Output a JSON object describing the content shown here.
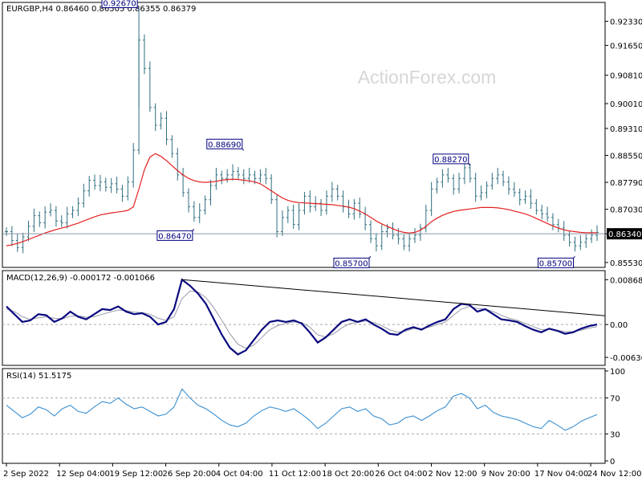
{
  "chart_data": [
    {
      "type": "ohlc",
      "symbol_info": "EURGBP,H4  0.86460 0.86505 0.86355 0.86379",
      "watermark": "ActionForex.com",
      "ylim": [
        0.8546,
        0.9275
      ],
      "y_ticks": [
        "0.92330",
        "0.91650",
        "0.90810",
        "0.90010",
        "0.89310",
        "0.88550",
        "0.87790",
        "0.87030",
        "0.86340",
        "0.85530"
      ],
      "current_price": "0.86340",
      "current_value": 0.8634,
      "x_labels": [
        "2 Sep 2022",
        "12 Sep 04:00",
        "19 Sep 12:00",
        "26 Sep 20:00",
        "4 Oct 04:00",
        "11 Oct 12:00",
        "18 Oct 20:00",
        "26 Oct 04:00",
        "2 Nov 12:00",
        "9 Nov 20:00",
        "17 Nov 04:00",
        "24 Nov 12:00"
      ],
      "closes": [
        0.864,
        0.8615,
        0.8595,
        0.8625,
        0.8655,
        0.8685,
        0.8665,
        0.8695,
        0.87,
        0.867,
        0.8665,
        0.869,
        0.87,
        0.872,
        0.8755,
        0.8785,
        0.877,
        0.878,
        0.8765,
        0.8775,
        0.876,
        0.874,
        0.878,
        0.887,
        0.918,
        0.91,
        0.899,
        0.894,
        0.896,
        0.89,
        0.886,
        0.88,
        0.875,
        0.871,
        0.868,
        0.87,
        0.873,
        0.877,
        0.88,
        0.879,
        0.88,
        0.881,
        0.88,
        0.879,
        0.88,
        0.879,
        0.88,
        0.879,
        0.873,
        0.864,
        0.868,
        0.87,
        0.866,
        0.87,
        0.874,
        0.871,
        0.872,
        0.87,
        0.874,
        0.876,
        0.874,
        0.871,
        0.869,
        0.872,
        0.869,
        0.866,
        0.862,
        0.86,
        0.864,
        0.865,
        0.863,
        0.862,
        0.86,
        0.862,
        0.863,
        0.865,
        0.87,
        0.876,
        0.878,
        0.88,
        0.879,
        0.876,
        0.879,
        0.882,
        0.879,
        0.874,
        0.875,
        0.877,
        0.879,
        0.88,
        0.878,
        0.876,
        0.875,
        0.873,
        0.874,
        0.872,
        0.87,
        0.869,
        0.868,
        0.866,
        0.865,
        0.863,
        0.861,
        0.86,
        0.861,
        0.862,
        0.863,
        0.8638
      ],
      "ma": [
        0.86,
        0.8603,
        0.8607,
        0.8612,
        0.8618,
        0.8624,
        0.863,
        0.8636,
        0.8641,
        0.8646,
        0.865,
        0.8654,
        0.8659,
        0.8664,
        0.867,
        0.8676,
        0.8682,
        0.8687,
        0.869,
        0.8693,
        0.8695,
        0.8697,
        0.87,
        0.871,
        0.876,
        0.8815,
        0.885,
        0.886,
        0.8852,
        0.884,
        0.8826,
        0.8812,
        0.88,
        0.879,
        0.8784,
        0.878,
        0.8779,
        0.878,
        0.8782,
        0.8785,
        0.8787,
        0.8788,
        0.8787,
        0.8785,
        0.8783,
        0.878,
        0.8775,
        0.8765,
        0.8755,
        0.8745,
        0.8735,
        0.8728,
        0.8724,
        0.8722,
        0.8721,
        0.872,
        0.8719,
        0.8718,
        0.8717,
        0.8716,
        0.8714,
        0.8712,
        0.8709,
        0.8705,
        0.8698,
        0.869,
        0.868,
        0.867,
        0.8662,
        0.8655,
        0.8648,
        0.8642,
        0.8638,
        0.8636,
        0.8638,
        0.8644,
        0.8655,
        0.8668,
        0.8678,
        0.8686,
        0.8692,
        0.8697,
        0.87,
        0.8702,
        0.8704,
        0.8706,
        0.8708,
        0.8708,
        0.8708,
        0.8707,
        0.8705,
        0.8702,
        0.8698,
        0.8694,
        0.869,
        0.8684,
        0.8677,
        0.867,
        0.8663,
        0.8656,
        0.865,
        0.8645,
        0.8642,
        0.864,
        0.8638,
        0.8637,
        0.8637,
        0.8637
      ],
      "annotations": [
        {
          "label": "0.92670",
          "value": 0.9267,
          "index": 24
        },
        {
          "label": "0.88690",
          "value": 0.8869,
          "index": 43
        },
        {
          "label": "0.86470",
          "value": 0.8647,
          "index": 34
        },
        {
          "label": "0.85700",
          "value": 0.857,
          "index": 66
        },
        {
          "label": "0.88270",
          "value": 0.8827,
          "index": 84
        },
        {
          "label": "0.85700",
          "value": 0.857,
          "index": 103
        }
      ],
      "colors": {
        "bars": "#2f6f7f",
        "ma": "#e52020",
        "price_line": "#8899aa"
      }
    },
    {
      "type": "line",
      "title": "MACD(12,26,9) -0.000172 -0.001066",
      "ylim": [
        -0.0076,
        0.0092
      ],
      "y_ticks": [
        "0.008686",
        "0.00",
        "-0.006366"
      ],
      "current_value": "0.00",
      "macd": [
        0.0035,
        0.002,
        0.0005,
        0.0008,
        0.002,
        0.0018,
        0.0005,
        0.0012,
        0.0025,
        0.0015,
        0.001,
        0.002,
        0.003,
        0.0028,
        0.0035,
        0.0025,
        0.002,
        0.0022,
        0.0015,
        0.0,
        0.0005,
        0.003,
        0.0087,
        0.0075,
        0.006,
        0.004,
        0.001,
        -0.002,
        -0.0045,
        -0.0058,
        -0.005,
        -0.003,
        -0.001,
        0.0005,
        0.0008,
        0.0005,
        0.0008,
        0.0002,
        -0.0015,
        -0.0035,
        -0.0025,
        -0.001,
        0.0005,
        0.001,
        0.0005,
        0.001,
        0.0,
        -0.0008,
        -0.0018,
        -0.002,
        -0.001,
        -0.0005,
        -0.001,
        -0.0002,
        0.0005,
        0.001,
        0.003,
        0.004,
        0.0038,
        0.0025,
        0.003,
        0.002,
        0.001,
        0.0008,
        0.0005,
        -0.0003,
        -0.001,
        -0.0015,
        -0.0008,
        -0.0012,
        -0.0018,
        -0.0015,
        -0.0008,
        -0.0003,
        0.0
      ],
      "signal": [
        0.003,
        0.0025,
        0.0015,
        0.001,
        0.0013,
        0.0015,
        0.0012,
        0.0011,
        0.0016,
        0.0017,
        0.0014,
        0.0015,
        0.002,
        0.0024,
        0.0028,
        0.0027,
        0.0024,
        0.0023,
        0.002,
        0.0012,
        0.0008,
        0.0015,
        0.005,
        0.0065,
        0.0063,
        0.0052,
        0.0032,
        0.0008,
        -0.0018,
        -0.0038,
        -0.0046,
        -0.004,
        -0.0025,
        -0.001,
        -0.0002,
        0.0002,
        0.0005,
        0.0004,
        -0.0005,
        -0.002,
        -0.0024,
        -0.0018,
        -0.0007,
        0.0002,
        0.0004,
        0.0007,
        0.0004,
        -0.0002,
        -0.001,
        -0.0015,
        -0.0013,
        -0.0008,
        -0.0008,
        -0.0005,
        0.0,
        0.0005,
        0.0018,
        0.003,
        0.0035,
        0.0031,
        0.003,
        0.0025,
        0.0018,
        0.0012,
        0.0008,
        0.0002,
        -0.0004,
        -0.001,
        -0.0009,
        -0.0011,
        -0.0014,
        -0.0014,
        -0.0011,
        -0.0007,
        -0.0004
      ],
      "trendline": [
        {
          "index": 22,
          "value": 0.0087
        },
        {
          "index": 74,
          "value": 0.0017
        }
      ],
      "colors": {
        "macd": "#0a0a80",
        "signal": "#9999aa",
        "trendline": "#000000"
      }
    },
    {
      "type": "line",
      "title": "RSI(14) 51.5175",
      "ylim": [
        0,
        100
      ],
      "y_ticks": [
        "100",
        "70",
        "30",
        "0"
      ],
      "levels": [
        70,
        30
      ],
      "rsi": [
        62,
        55,
        48,
        52,
        60,
        57,
        50,
        58,
        62,
        55,
        53,
        60,
        66,
        64,
        70,
        63,
        58,
        60,
        55,
        50,
        52,
        60,
        80,
        70,
        62,
        58,
        52,
        45,
        40,
        38,
        42,
        50,
        56,
        60,
        58,
        55,
        58,
        52,
        45,
        36,
        42,
        50,
        58,
        60,
        55,
        58,
        50,
        47,
        40,
        42,
        48,
        50,
        45,
        50,
        56,
        60,
        72,
        75,
        70,
        58,
        62,
        54,
        50,
        48,
        46,
        42,
        38,
        36,
        45,
        40,
        34,
        38,
        44,
        48,
        51.5
      ],
      "colors": {
        "rsi": "#3a8fd0",
        "levels": "#aaaaaa"
      }
    }
  ]
}
